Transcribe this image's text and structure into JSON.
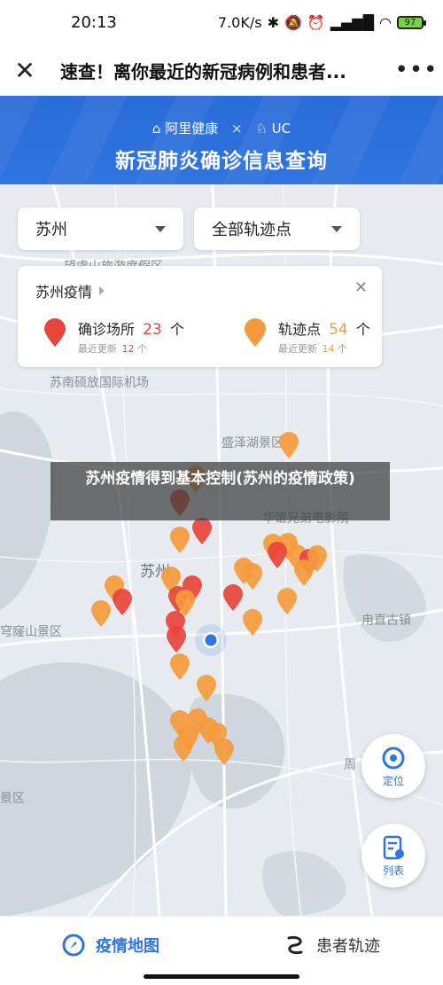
{
  "status_bar": {
    "time": "20:13",
    "net_speed": "7.0K/s",
    "battery": "97"
  },
  "app_bar": {
    "title": "速查！离你最近的新冠病例和患者..."
  },
  "banner": {
    "brand_alibaba": "阿里健康",
    "brand_separator": "×",
    "brand_uc": "UC",
    "headline": "新冠肺炎确诊信息查询"
  },
  "filters": {
    "city": "苏州",
    "point_type": "全部轨迹点"
  },
  "info_card": {
    "heading": "苏州疫情",
    "confirmed": {
      "label": "确诊场所",
      "count": "23",
      "unit": "个",
      "updated_label": "最近更新",
      "updated_count": "12",
      "updated_unit": "个"
    },
    "tracks": {
      "label": "轨迹点",
      "count": "54",
      "unit": "个",
      "updated_label": "最近更新",
      "updated_count": "14",
      "updated_unit": "个"
    },
    "colors": {
      "confirmed": "#e8443a",
      "tracks": "#f59a3c"
    }
  },
  "map_labels": {
    "airport": "苏南硕放国际机场",
    "lake_park": "盛泽湖景区",
    "cinema": "华谊兄弟电影院",
    "city": "苏州",
    "qionglong": "穹窿山景区",
    "luzhi": "甪直古镇",
    "zhou": "周",
    "west_area": "景区",
    "top_partial": "望虞山旅游度假区"
  },
  "caption": "苏州疫情得到基本控制(苏州的疫情政策)",
  "fab": {
    "locate": "定位",
    "list": "列表"
  },
  "tabs": {
    "map": "疫情地图",
    "tracks": "患者轨迹"
  },
  "icons": [
    "close-icon",
    "more-icon",
    "caret-down-icon",
    "pin-icon",
    "locate-icon",
    "list-icon",
    "compass-icon",
    "track-icon"
  ]
}
